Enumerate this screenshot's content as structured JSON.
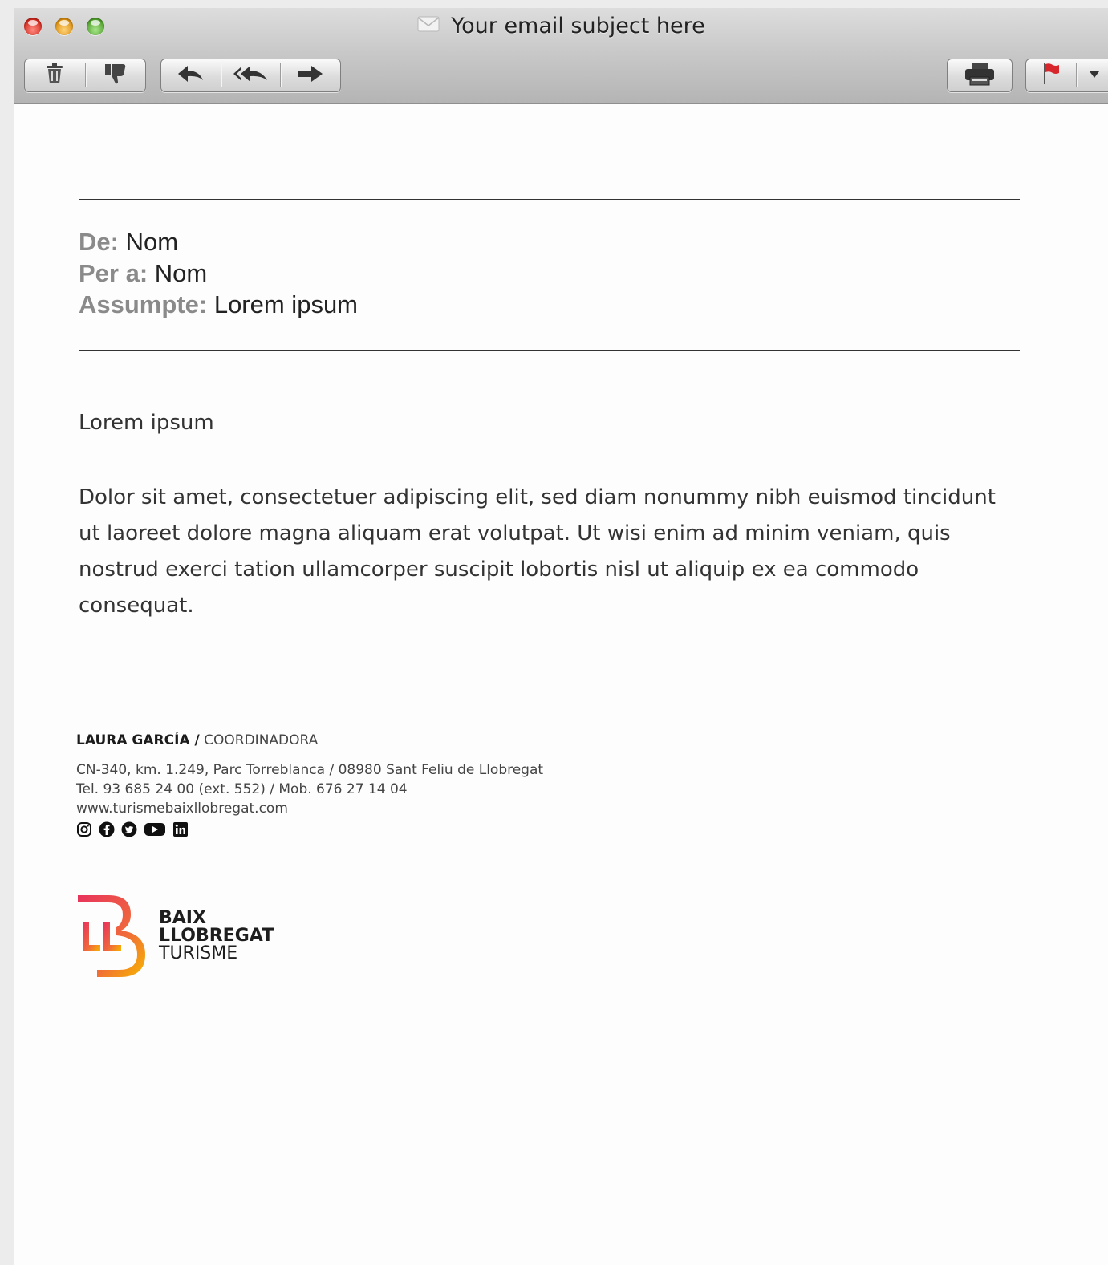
{
  "window": {
    "title": "Your email subject here"
  },
  "toolbar": {
    "delete_icon": "trash-icon",
    "junk_icon": "thumbs-down-icon",
    "reply_icon": "reply-icon",
    "reply_all_icon": "reply-all-icon",
    "forward_icon": "forward-icon",
    "print_icon": "printer-icon",
    "flag_icon": "flag-icon",
    "flag_menu_icon": "chevron-down-icon"
  },
  "header": {
    "from_label": "De:",
    "from_value": "Nom",
    "to_label": "Per a:",
    "to_value": "Nom",
    "subject_label": "Assumpte:",
    "subject_value": "Lorem ipsum"
  },
  "message": {
    "greeting": "Lorem ipsum",
    "paragraph": "Dolor sit amet, consectetuer adipiscing elit, sed diam nonummy nibh euismod tincidunt ut laoreet dolore magna aliquam erat volutpat. Ut wisi enim ad minim veniam, quis nostrud exerci tation ullamcorper suscipit lobortis nisl ut aliquip ex ea commodo consequat."
  },
  "signature": {
    "name": "LAURA GARCÍA /",
    "role": "COORDINADORA",
    "address": "CN-340, km. 1.249, Parc Torreblanca / 08980 Sant Feliu de Llobregat",
    "phone": "Tel. 93 685 24 00 (ext. 552) / Mob. 676 27 14 04",
    "website": "www.turismebaixllobregat.com",
    "social_icons": [
      "instagram-icon",
      "facebook-icon",
      "twitter-icon",
      "youtube-icon",
      "linkedin-icon"
    ]
  },
  "logo": {
    "line1": "BAIX",
    "line2": "LLOBREGAT",
    "line3": "TURISME",
    "gradient_start": "#e8335d",
    "gradient_end": "#f7b500"
  }
}
